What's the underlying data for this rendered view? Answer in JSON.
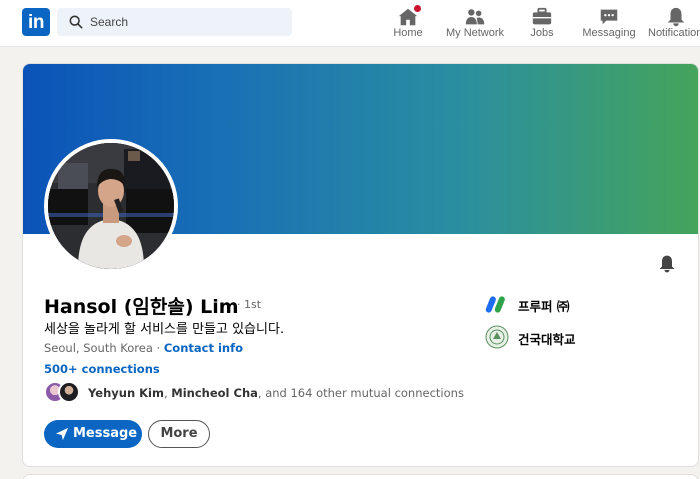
{
  "nav": {
    "search_placeholder": "Search",
    "items": [
      {
        "label": "Home",
        "icon": "home-icon"
      },
      {
        "label": "My Network",
        "icon": "my-network-icon"
      },
      {
        "label": "Jobs",
        "icon": "jobs-icon"
      },
      {
        "label": "Messaging",
        "icon": "messaging-icon"
      },
      {
        "label": "Notifications",
        "icon": "bell-icon"
      }
    ]
  },
  "profile": {
    "name": "Hansol (임한솔) Lim",
    "degree": "· 1st",
    "headline": "세상을 놀라게 할 서비스를 만들고 있습니다.",
    "location": "Seoul, South Korea ·",
    "contact_info": "Contact info",
    "connections": "500+ connections",
    "mutual": {
      "name1": "Yehyun Kim",
      "sep": ", ",
      "name2": "Mincheol Cha",
      "rest": ", and 164 other mutual connections"
    },
    "buttons": {
      "message": "Message",
      "more": "More"
    },
    "companies": [
      {
        "name": "프루퍼 ㈜",
        "icon": "proofer-logo-icon"
      },
      {
        "name": "건국대학교",
        "icon": "konkuk-university-logo-icon"
      }
    ]
  },
  "colors": {
    "brand": "#0a66c2",
    "badge": "#cb112d",
    "banner_start": "#0b53b8",
    "banner_end": "#45a45a"
  }
}
